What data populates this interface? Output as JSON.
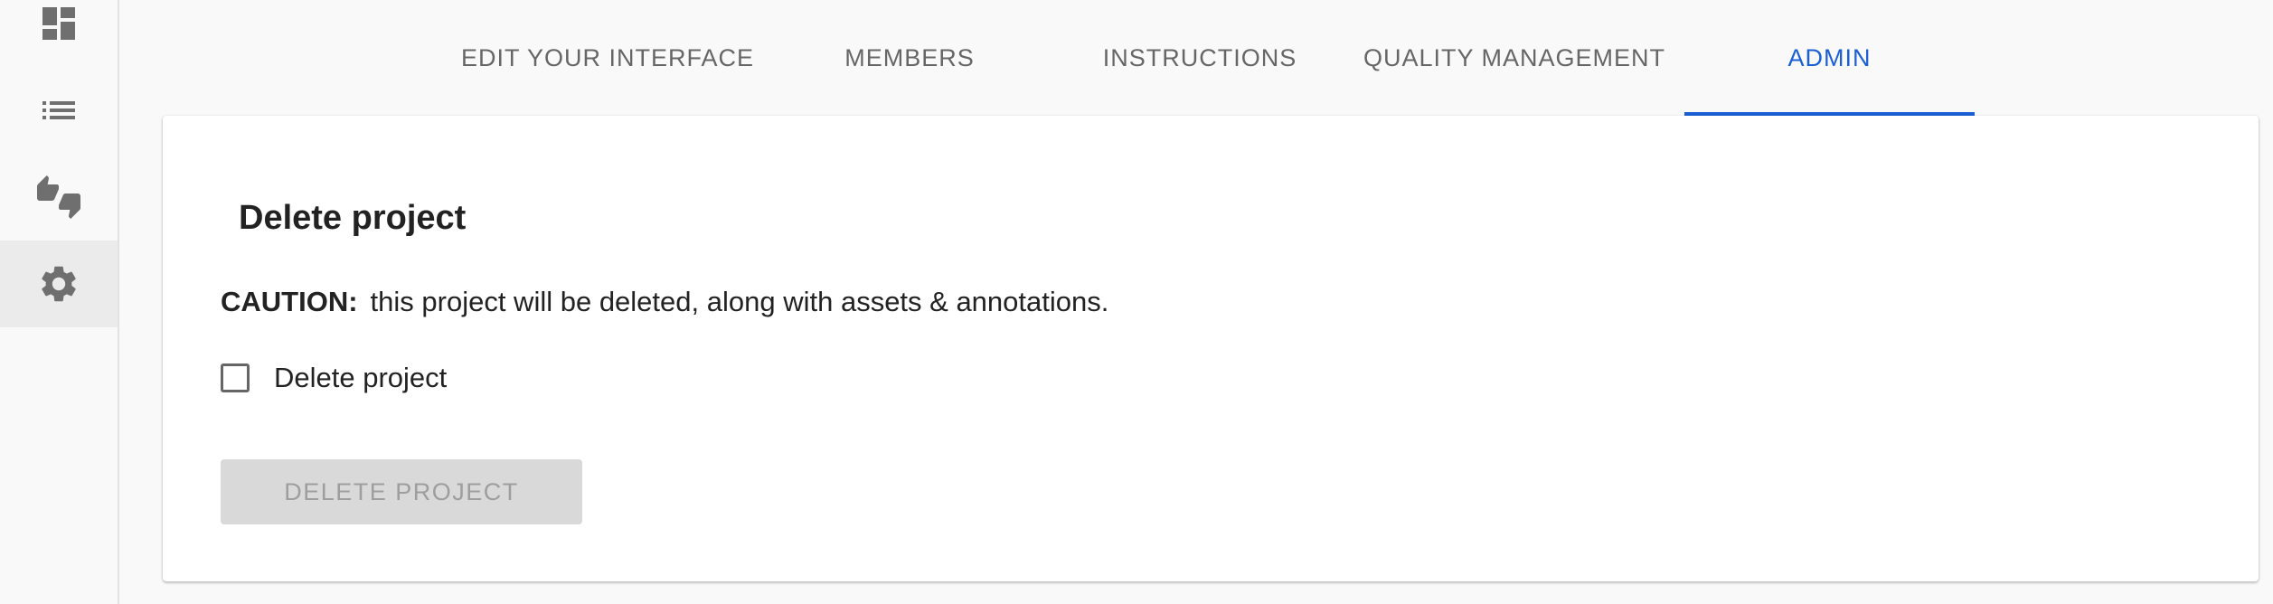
{
  "sidebar": {
    "items": [
      {
        "icon": "dashboard-icon",
        "active": false
      },
      {
        "icon": "list-icon",
        "active": false
      },
      {
        "icon": "thumbs-up-down-icon",
        "active": false
      },
      {
        "icon": "gear-icon",
        "active": true
      }
    ]
  },
  "tabs": [
    {
      "label": "EDIT YOUR INTERFACE",
      "active": false
    },
    {
      "label": "MEMBERS",
      "active": false
    },
    {
      "label": "INSTRUCTIONS",
      "active": false
    },
    {
      "label": "QUALITY MANAGEMENT",
      "active": false
    },
    {
      "label": "ADMIN",
      "active": true
    }
  ],
  "admin": {
    "section_title": "Delete project",
    "caution_label": "CAUTION:",
    "caution_text": "this project will be deleted, along with assets & annotations.",
    "checkbox_label": "Delete project",
    "checkbox_checked": false,
    "delete_button_label": "DELETE PROJECT",
    "delete_button_disabled": true
  },
  "colors": {
    "accent": "#1a5fd6",
    "tab_text": "#666666",
    "disabled_button_bg": "#d9d9d9",
    "disabled_button_text": "#9e9e9e"
  }
}
